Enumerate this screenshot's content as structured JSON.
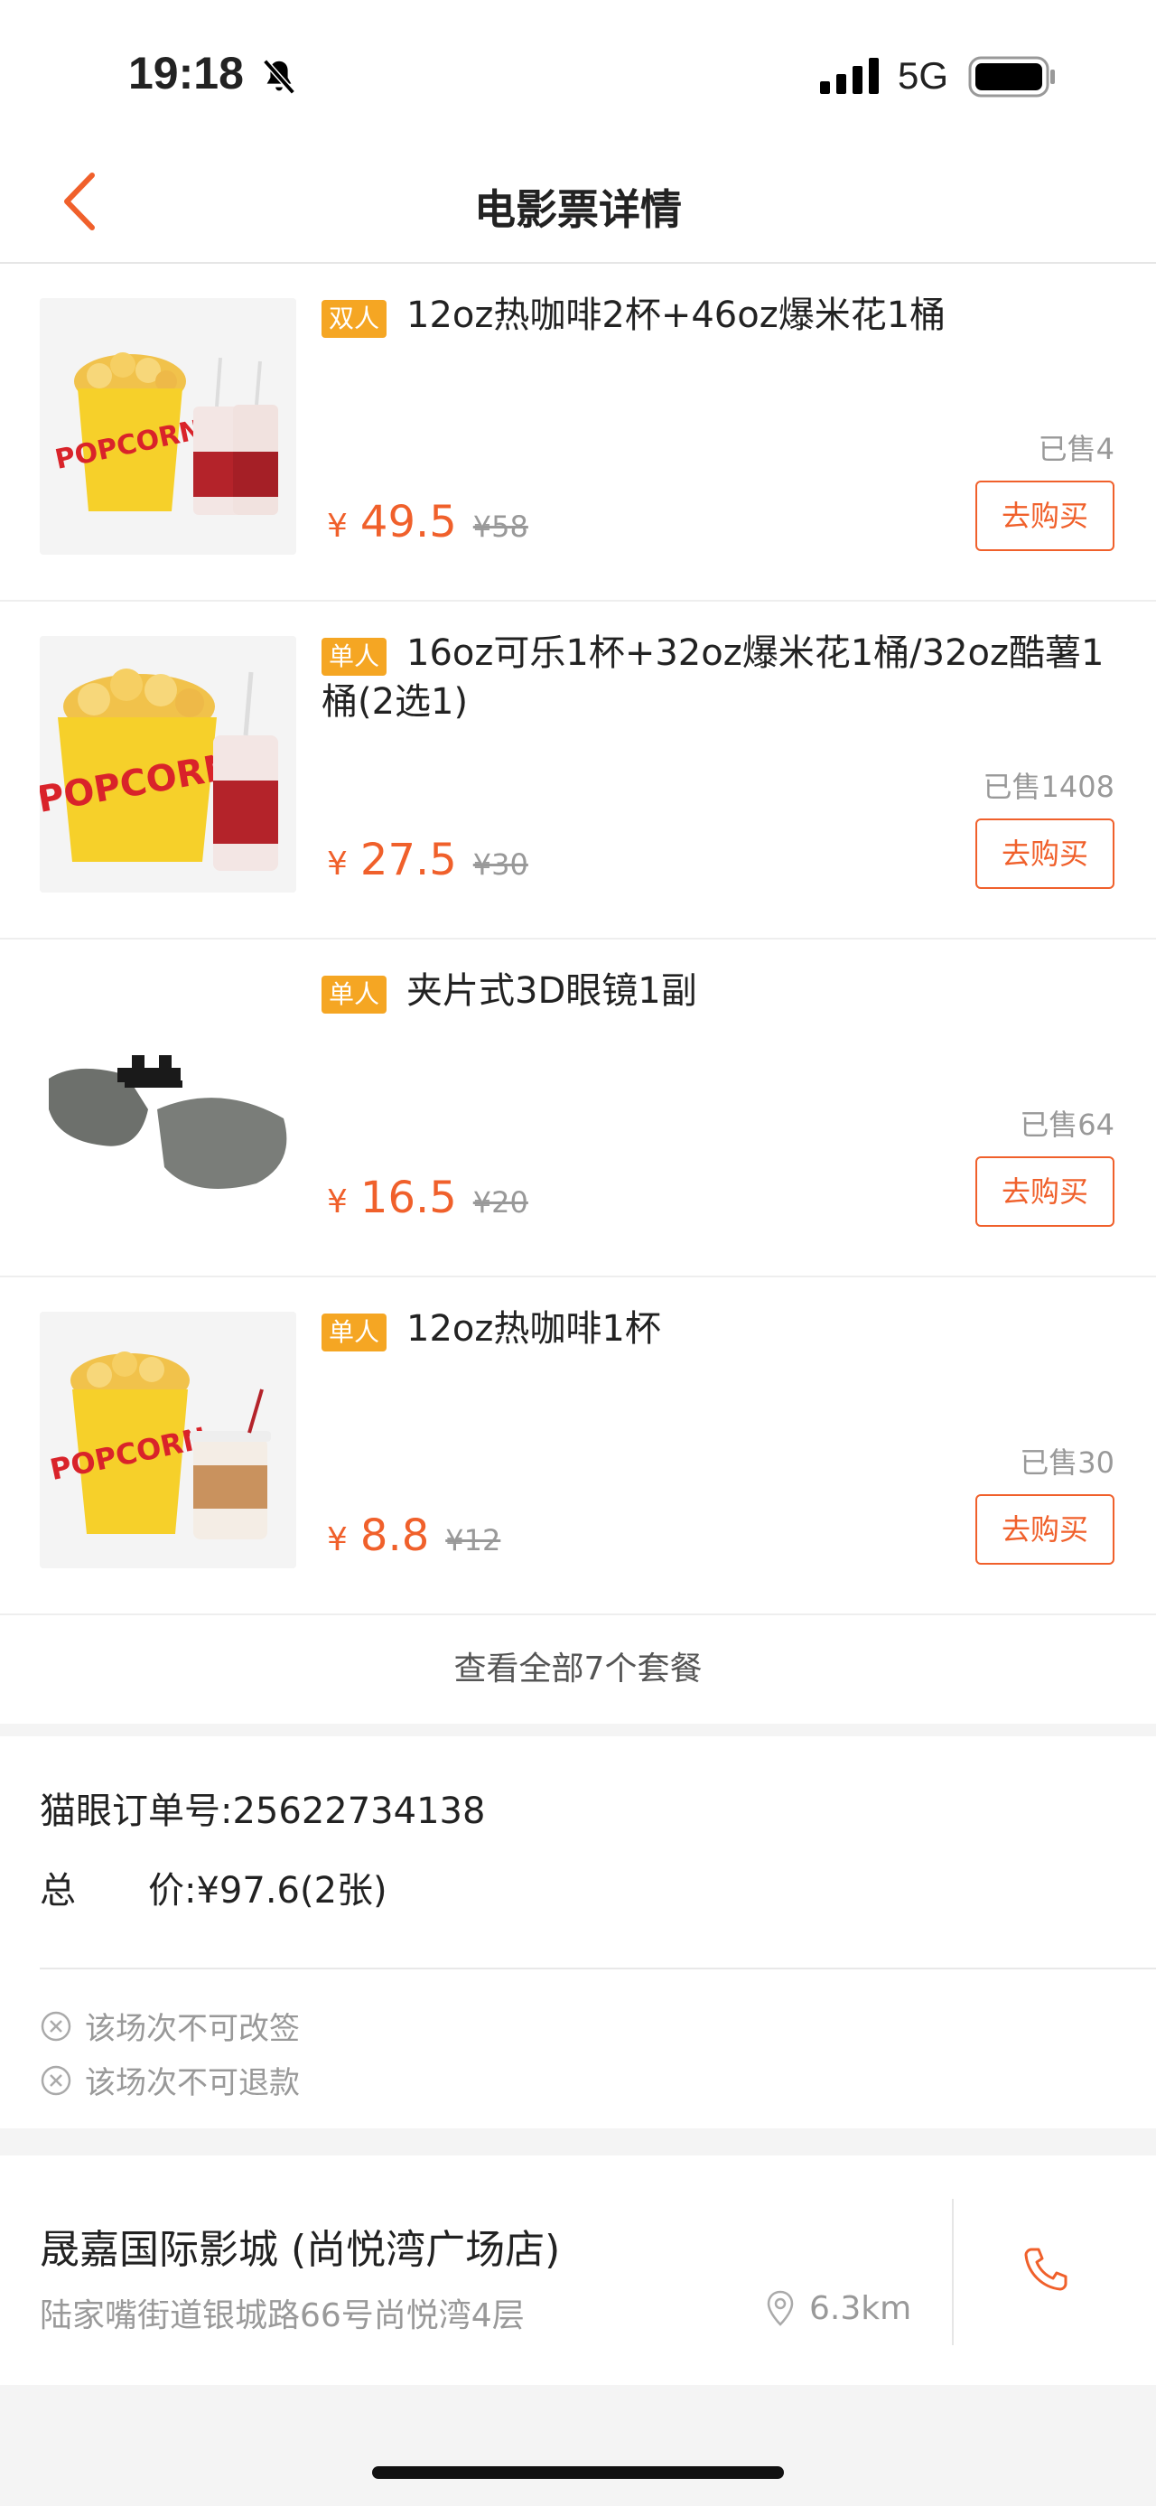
{
  "status_bar": {
    "time": "19:18",
    "network": "5G"
  },
  "header": {
    "title": "电影票详情"
  },
  "snacks": [
    {
      "tag": "双人",
      "name": "12oz热咖啡2杯+46oz爆米花1桶",
      "sold": "已售4",
      "price": "49.5",
      "original": "¥58",
      "button": "去购买",
      "image": "popcorn-and-two-cups"
    },
    {
      "tag": "单人",
      "name": "16oz可乐1杯+32oz爆米花1桶/32oz酷薯1桶(2选1)",
      "sold": "已售1408",
      "price": "27.5",
      "original": "¥30",
      "button": "去购买",
      "image": "popcorn-and-cola"
    },
    {
      "tag": "单人",
      "name": "夹片式3D眼镜1副",
      "sold": "已售64",
      "price": "16.5",
      "original": "¥20",
      "button": "去购买",
      "image": "clip-on-3d-glasses"
    },
    {
      "tag": "单人",
      "name": "12oz热咖啡1杯",
      "sold": "已售30",
      "price": "8.8",
      "original": "¥12",
      "button": "去购买",
      "image": "popcorn-and-coffee"
    }
  ],
  "currency": "¥",
  "more_link": "查看全部7个套餐",
  "order": {
    "number_label": "猫眼订单号:",
    "number": "25622734138",
    "total_label": "总　　价:",
    "total": "¥97.6(2张)",
    "notes": [
      "该场次不可改签",
      "该场次不可退款"
    ]
  },
  "cinema": {
    "name": "晟嘉国际影城 (尚悦湾广场店)",
    "address": "陆家嘴街道银城路66号尚悦湾4层",
    "distance": "6.3km"
  },
  "colors": {
    "accent": "#f0602b",
    "tag": "#f5a623",
    "muted": "#999999"
  }
}
